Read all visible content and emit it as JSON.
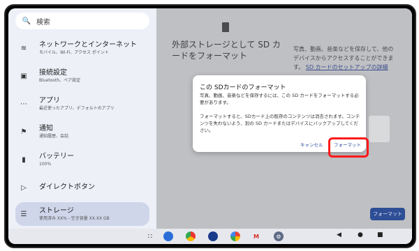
{
  "search": {
    "placeholder": "検索"
  },
  "sidebar": {
    "items": [
      {
        "label": "ネットワークとインターネット",
        "sub": "モバイル、Wi-Fi、アクセス ポイント",
        "icon": "wifi-icon"
      },
      {
        "label": "接続設定",
        "sub": "Bluetooth、ペア設定",
        "icon": "devices-icon"
      },
      {
        "label": "アプリ",
        "sub": "最近使ったアプリ、デフォルトのアプリ",
        "icon": "apps-grid-icon"
      },
      {
        "label": "通知",
        "sub": "通知履歴、会話",
        "icon": "bell-icon"
      },
      {
        "label": "バッテリー",
        "sub": "100%",
        "icon": "battery-icon"
      },
      {
        "label": "ダイレクトボタン",
        "sub": "",
        "icon": "direct-button-icon"
      },
      {
        "label": "ストレージ",
        "sub": "使用済み XX% - 空き容量 XX.XX GB",
        "icon": "storage-icon"
      }
    ]
  },
  "pane": {
    "title": "外部ストレージとして SD カードをフォーマット",
    "desc": "写真、動画、音楽などを保存して、他のデバイスからアクセスすることができます。",
    "link": "SD カードのセットアップの詳細",
    "format_button": "フォーマット"
  },
  "dialog": {
    "title": "この SDカードのフォーマット",
    "p1": "写真、動画、音楽などを保存するには、この SD カードをフォーマットする必要があります。",
    "p2": "フォーマットすると、SDカード上の既存のコンテンツは消去されます。コンテンツを失わないよう、別の SD カードまたはデバイスにバックアップしてください。",
    "cancel": "キャンセル",
    "confirm": "フォーマット"
  },
  "taskbar": {
    "apps": [
      "app-drawer-icon",
      "assistant-icon",
      "chrome-icon",
      "camera-icon",
      "photos-icon",
      "gmail-icon",
      "settings-icon"
    ]
  },
  "nav": {
    "back": "◀",
    "home": "●",
    "recents": "■"
  }
}
